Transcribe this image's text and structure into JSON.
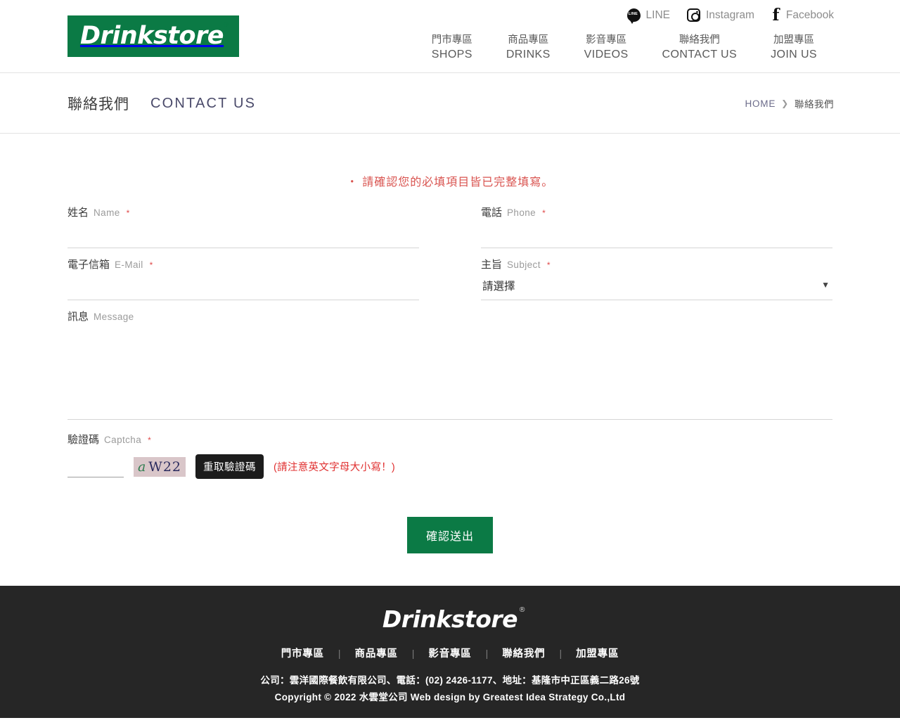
{
  "header": {
    "logo_text": "Drinkstore",
    "logo_reg": "®",
    "social": [
      {
        "icon": "line-icon",
        "label": "LINE"
      },
      {
        "icon": "instagram-icon",
        "label": "Instagram"
      },
      {
        "icon": "facebook-icon",
        "label": "Facebook"
      }
    ],
    "nav": [
      {
        "cn": "門市專區",
        "en": "SHOPS"
      },
      {
        "cn": "商品專區",
        "en": "DRINKS"
      },
      {
        "cn": "影音專區",
        "en": "VIDEOS"
      },
      {
        "cn": "聯絡我們",
        "en": "CONTACT US"
      },
      {
        "cn": "加盟專區",
        "en": "JOIN US"
      }
    ]
  },
  "page": {
    "title_cn": "聯絡我們",
    "title_en": "CONTACT US",
    "breadcrumb_home": "HOME",
    "breadcrumb_sep": "❯",
    "breadcrumb_current": "聯絡我們"
  },
  "form": {
    "notice": "‧ 請確認您的必填項目皆已完整填寫。",
    "required_mark": "*",
    "name": {
      "cn": "姓名",
      "en": "Name",
      "value": "",
      "placeholder": ""
    },
    "phone": {
      "cn": "電話",
      "en": "Phone",
      "value": "",
      "placeholder": ""
    },
    "email": {
      "cn": "電子信箱",
      "en": "E-Mail",
      "value": "",
      "placeholder": ""
    },
    "subject": {
      "cn": "主旨",
      "en": "Subject",
      "selected": "請選擇",
      "arrow": "▼",
      "options": [
        "請選擇"
      ]
    },
    "message": {
      "cn": "訊息",
      "en": "Message",
      "value": "",
      "placeholder": ""
    },
    "captcha": {
      "cn": "驗證碼",
      "en": "Captcha",
      "value": "",
      "image_first": "a",
      "image_rest": "W22",
      "refresh_label": "重取驗證碼",
      "hint": "(請注意英文字母大小寫！)"
    },
    "submit_label": "確認送出"
  },
  "footer": {
    "logo_text": "Drinkstore",
    "logo_reg": "®",
    "nav": [
      "門市專區",
      "商品專區",
      "影音專區",
      "聯絡我們",
      "加盟專區"
    ],
    "nav_sep": "|",
    "info_line1": "公司：雲洋國際餐飲有限公司、電話：(02) 2426-1177、地址：基隆市中正區義二路26號",
    "info_line2": "Copyright © 2022 水雲堂公司 Web design by Greatest Idea Strategy Co.,Ltd"
  },
  "colors": {
    "brand_green": "#0b7a45",
    "footer_bg": "#262626",
    "notice_red": "#d9534f",
    "required_red": "#e04a4a"
  }
}
